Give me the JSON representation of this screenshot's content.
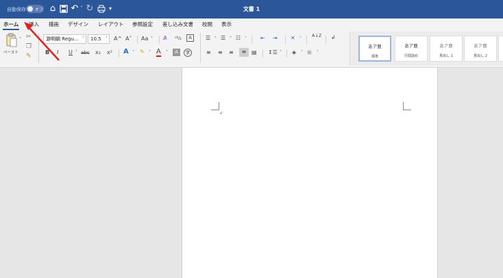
{
  "titlebar": {
    "autosave_label": "自動保存",
    "autosave_state": "オフ",
    "doc_title": "文書 1",
    "icons": [
      "home-icon",
      "save-icon",
      "undo-icon",
      "redo-icon",
      "print-icon",
      "customize-icon"
    ]
  },
  "tabs": [
    "ホーム",
    "挿入",
    "描画",
    "デザイン",
    "レイアウト",
    "参照設定",
    "差し込み文書",
    "校閲",
    "表示"
  ],
  "ribbon": {
    "paste_label": "ペースト",
    "font_name": "游明朝 Regu...",
    "font_size": "10.5",
    "grow_font": "A^",
    "shrink_font": "A˅",
    "change_case": "Aa",
    "bold": "B",
    "italic": "I",
    "underline": "U",
    "strike": "abc",
    "subscript": "x₂",
    "superscript": "x²",
    "sort": "A↓Z"
  },
  "styles": [
    {
      "sample": "あア亜",
      "name": "標準"
    },
    {
      "sample": "あア亜",
      "name": "行間詰め"
    },
    {
      "sample": "あア亜",
      "name": "見出し 1"
    },
    {
      "sample": "あア亜",
      "name": "見出し 2"
    }
  ],
  "annotation": {
    "color": "#e02020"
  }
}
